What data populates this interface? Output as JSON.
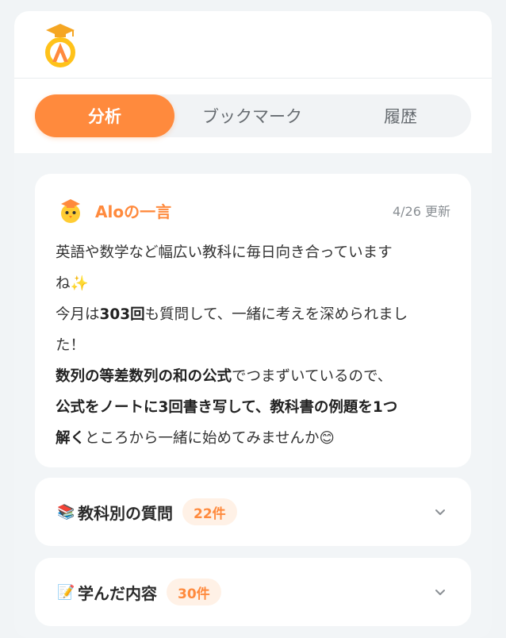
{
  "tabs": [
    {
      "label": "分析",
      "active": true
    },
    {
      "label": "ブックマーク",
      "active": false
    },
    {
      "label": "履歴",
      "active": false
    }
  ],
  "summary": {
    "title": "Aloの一言",
    "updated": "4/26 更新",
    "lines": {
      "l1": "英語や数学など幅広い教科に毎日向き合っていま",
      "l1b": "す",
      "l2": "ね✨",
      "l3_pre": "今月は",
      "l3_bold": "303回",
      "l3_post": "も質問して、一緒に考えを深められまし",
      "l4": "た！",
      "l5_bold": "数列の等差数列の和の公式",
      "l5_post": "でつまずいているので、",
      "l6_bold": "公式をノートに3回書き写して、教科書の例題を1つ",
      "l7_bold": "解く",
      "l7_post": "ところから一緒に始めてみませんか😊"
    }
  },
  "sections": [
    {
      "emoji": "📚",
      "label": "教科別の質問",
      "badge": "22件"
    },
    {
      "emoji": "📝",
      "label": "学んだ内容",
      "badge": "30件"
    }
  ],
  "colors": {
    "accent": "#ff8a3d",
    "badge_bg": "#fff1e6",
    "page_bg": "#f2f5f7"
  },
  "icons": {
    "logo": "graduation-cap-logo-icon",
    "mascot": "mascot-chick-icon",
    "expand": "chevron-down-icon"
  }
}
